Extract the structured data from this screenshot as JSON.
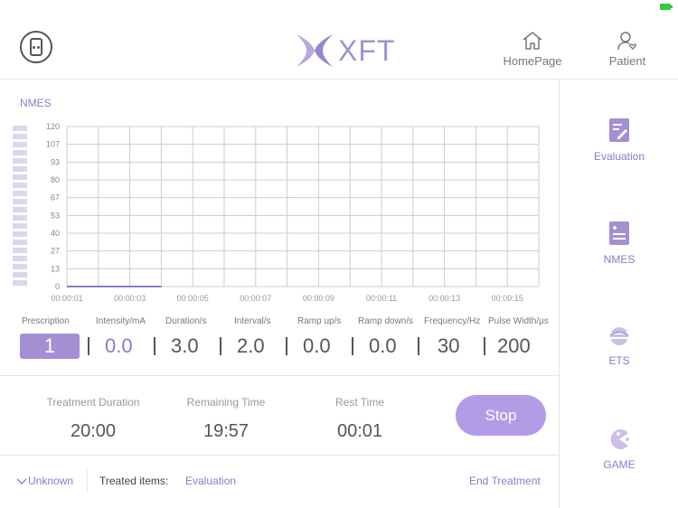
{
  "header": {
    "logo_text": "XFT",
    "nav": {
      "home": "HomePage",
      "patient": "Patient"
    }
  },
  "sidebar": {
    "items": [
      {
        "label": "Evaluation",
        "icon": "edit-doc-icon"
      },
      {
        "label": "NMES",
        "icon": "document-plus-icon"
      },
      {
        "label": "ETS",
        "icon": "globe-icon"
      },
      {
        "label": "GAME",
        "icon": "pacman-icon"
      }
    ]
  },
  "chart": {
    "title": "NMES",
    "level_segments": 20
  },
  "chart_data": {
    "type": "line",
    "yticks": [
      120,
      107,
      93,
      80,
      67,
      53,
      40,
      27,
      13,
      0
    ],
    "xticks": [
      "00:00:01",
      "00:00:03",
      "00:00:05",
      "00:00:07",
      "00:00:09",
      "00:00:11",
      "00:00:13",
      "00:00:15"
    ],
    "ylim": [
      0,
      120
    ],
    "xlim": [
      1,
      16
    ],
    "grid": true,
    "series": [
      {
        "x": [
          1,
          2,
          3,
          4
        ],
        "y": [
          0,
          0,
          0,
          0
        ],
        "color": "#8b7bc8"
      }
    ]
  },
  "prescription": {
    "labels": [
      "Prescription",
      "Intensity/mA",
      "Duration/s",
      "Interval/s",
      "Ramp up/s",
      "Ramp down/s",
      "Frequency/Hz",
      "Pulse Width/μs"
    ],
    "values": [
      "1",
      "0.0",
      "3.0",
      "2.0",
      "0.0",
      "0.0",
      "30",
      "200"
    ]
  },
  "timers": {
    "treatment_label": "Treatment Duration",
    "treatment_value": "20:00",
    "remaining_label": "Remaining Time",
    "remaining_value": "19:57",
    "rest_label": "Rest Time",
    "rest_value": "00:01",
    "stop_label": "Stop"
  },
  "footer": {
    "unknown": "Unknown",
    "treated_label": "Treated items:",
    "treated_value": "Evaluation",
    "end_label": "End Treatment"
  },
  "colors": {
    "accent": "#a48fd3",
    "accent_text": "#8b7bc8",
    "grid": "#cccccc"
  }
}
